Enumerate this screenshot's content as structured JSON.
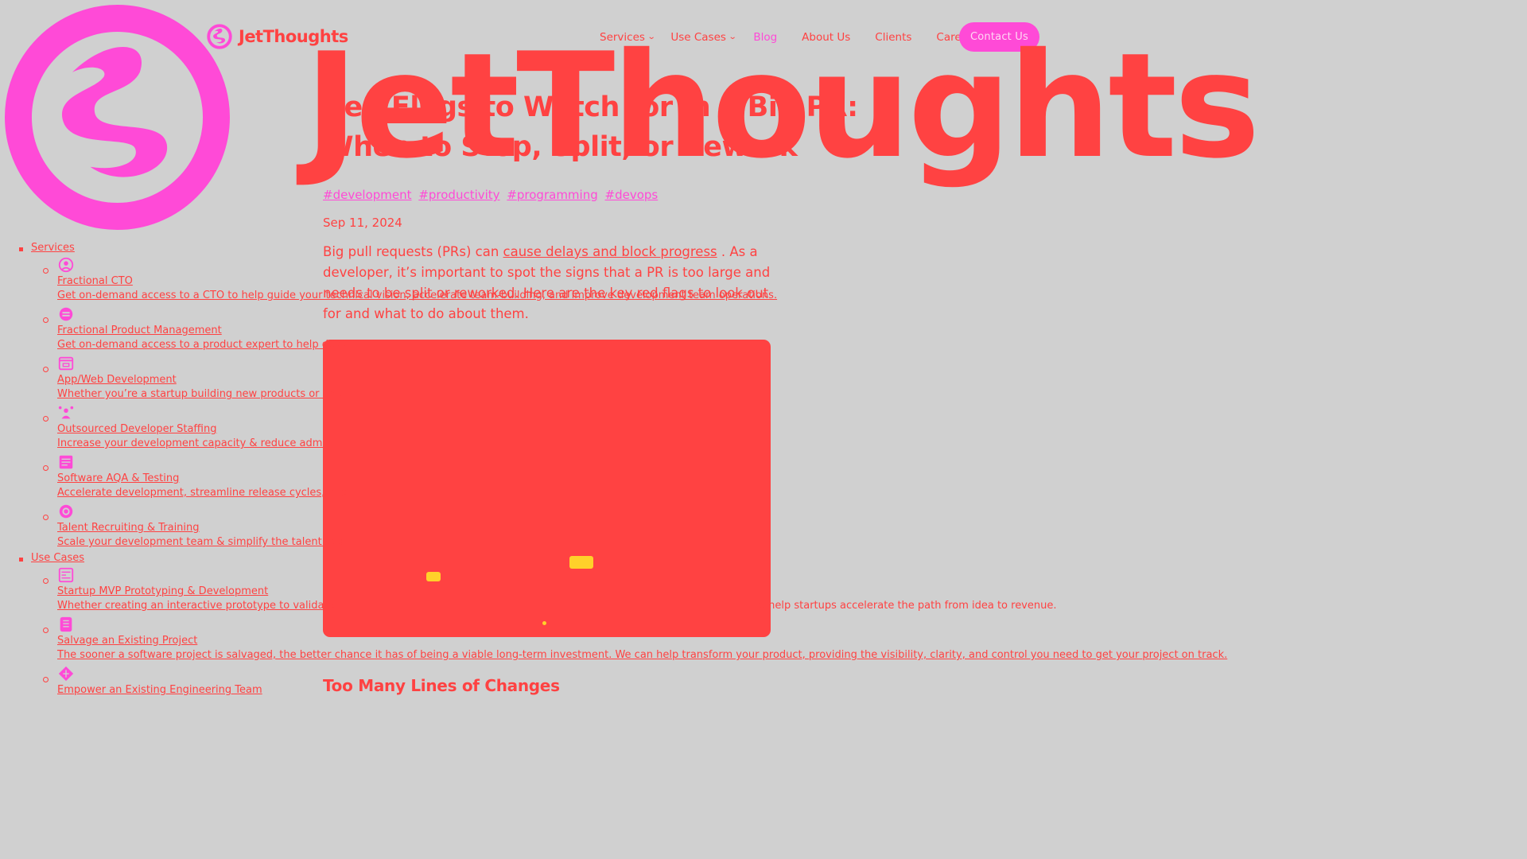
{
  "brand": {
    "name": "JetThoughts",
    "watermark": "JetThoughts"
  },
  "nav": {
    "items": [
      {
        "label": "Services",
        "has_dropdown": true
      },
      {
        "label": "Use Cases",
        "has_dropdown": true
      },
      {
        "label": "Blog",
        "active": true
      },
      {
        "label": "About Us"
      },
      {
        "label": "Clients"
      },
      {
        "label": "Careers"
      }
    ],
    "contact_label": "Contact Us"
  },
  "article": {
    "title": "Red Flags to Watch for in a Big PR: When to Stop, Split, or Rework",
    "tags": [
      "#development",
      "#productivity",
      "#programming",
      "#devops"
    ],
    "date": "Sep 11, 2024",
    "intro_before": "Big pull requests (PRs) can ",
    "intro_link": "cause delays and block progress",
    "intro_after": " . As a developer, it’s important to spot the signs that a PR is too large and needs to be split or reworked. Here are the key red flags to look out for and what to do about them.",
    "section_heading": "Too Many Lines of Changes"
  },
  "sidebar": {
    "services_label": "Services",
    "services": [
      {
        "icon": "cto-icon",
        "title": "Fractional CTO",
        "desc": "Get on-demand access to a CTO to help guide your technical vision, accelerate team-building, and improve development team operations."
      },
      {
        "icon": "product-icon",
        "title": "Fractional Product Management",
        "desc": "Get on-demand access to a product expert to help desig"
      },
      {
        "icon": "webdev-icon",
        "title": "App/Web Development",
        "desc": "Whether you’re a startup building new products or an e"
      },
      {
        "icon": "staffing-icon",
        "title": "Outsourced Developer Staffing",
        "desc": "Increase your development capacity & reduce administ"
      },
      {
        "icon": "qa-icon",
        "title": "Software AQA & Testing",
        "desc": "Accelerate development, streamline release cycles, and"
      },
      {
        "icon": "recruiting-icon",
        "title": "Talent Recruiting & Training",
        "desc": "Scale your development team & simplify the talent acq"
      }
    ],
    "usecases_label": "Use Cases",
    "usecases": [
      {
        "icon": "mvp-icon",
        "title": "Startup MVP Prototyping & Development",
        "desc": "Whether creating an interactive prototype to validate t",
        "desc_tail": "e help startups accelerate the path from idea to revenue."
      },
      {
        "icon": "salvage-icon",
        "title": "Salvage an Existing Project",
        "desc": "The sooner a software project is salvaged, the better chance it has of being a viable long-term investment. We can help transform your product, providing the visibility, clarity, and control you need to get your project on track."
      },
      {
        "icon": "team-icon",
        "title": "Empower an Existing Engineering Team",
        "desc": ""
      }
    ]
  },
  "colors": {
    "background": "#d0d0d0",
    "primary": "#ff4242",
    "accent": "#ff4ad7"
  }
}
